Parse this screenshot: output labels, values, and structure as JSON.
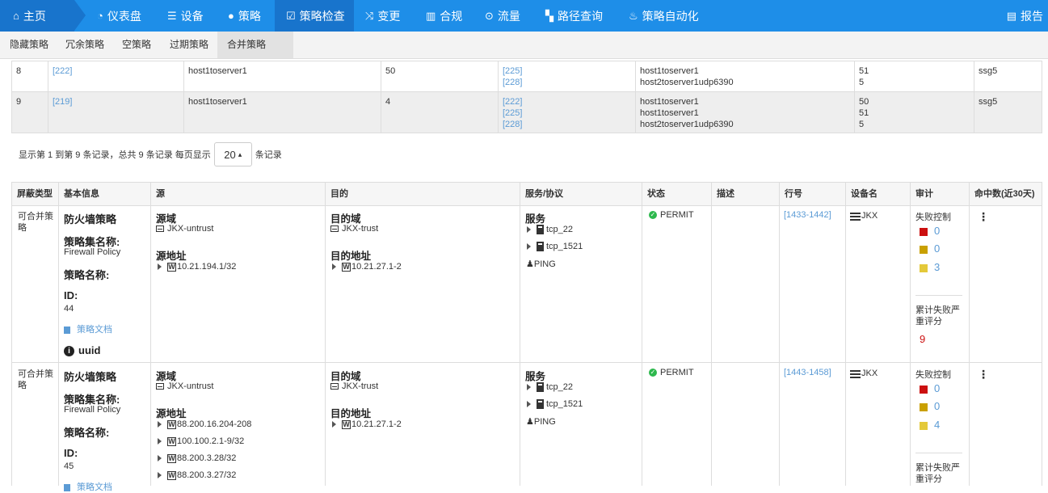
{
  "nav": {
    "home": "主页",
    "items": [
      "仪表盘",
      "设备",
      "策略",
      "策略检查",
      "变更",
      "合规",
      "流量",
      "路径查询",
      "策略自动化"
    ],
    "report": "报告"
  },
  "subnav": [
    "隐藏策略",
    "冗余策略",
    "空策略",
    "过期策略",
    "合并策略"
  ],
  "upper_rows": [
    {
      "no": "8",
      "id": "[222]",
      "name": "host1toserver1",
      "count": "50",
      "merge_ids": [
        "[225]",
        "[228]"
      ],
      "merge_names": [
        "host1toserver1",
        "host2toserver1udp6390"
      ],
      "merge_counts": [
        "51",
        "5"
      ],
      "device": "ssg5"
    },
    {
      "no": "9",
      "id": "[219]",
      "name": "host1toserver1",
      "count": "4",
      "merge_ids": [
        "[222]",
        "[225]",
        "[228]"
      ],
      "merge_names": [
        "host1toserver1",
        "host1toserver1",
        "host2toserver1udp6390"
      ],
      "merge_counts": [
        "50",
        "51",
        "5"
      ],
      "device": "ssg5"
    }
  ],
  "pager": {
    "text_before": "显示第 1 到第 9 条记录，总共 9 条记录 每页显示",
    "page_size": "20",
    "caret": "▴",
    "text_after": "条记录"
  },
  "headers": [
    "屏蔽类型",
    "基本信息",
    "源",
    "目的",
    "服务/协议",
    "状态",
    "描述",
    "行号",
    "设备名",
    "审计",
    "命中数(近30天)"
  ],
  "labels": {
    "policy_type": "防火墙策略",
    "set_label": "策略集名称:",
    "name_label": "策略名称:",
    "id_label": "ID:",
    "doc": "策略文档",
    "uuid": "uuid",
    "src_zone": "源域",
    "src_addr": "源地址",
    "dst_zone": "目的域",
    "dst_addr": "目的地址",
    "service": "服务",
    "fail_ctrl": "失败控制",
    "cum_score": "累计失败严重评分"
  },
  "rows": [
    {
      "type": "可合并策略",
      "set_name": "Firewall Policy",
      "id": "44",
      "src_zone": "JKX-untrust",
      "src_addrs": [
        "10.21.194.1/32"
      ],
      "dst_zone": "JKX-trust",
      "dst_addrs": [
        "10.21.27.1-2"
      ],
      "services": [
        "tcp_22",
        "tcp_1521"
      ],
      "ping": "PING",
      "status": "PERMIT",
      "line": "[1433-1442]",
      "device": "JKX",
      "audit": [
        "0",
        "0",
        "3"
      ],
      "score": "9"
    },
    {
      "type": "可合并策略",
      "set_name": "Firewall Policy",
      "id": "45",
      "src_zone": "JKX-untrust",
      "src_addrs": [
        "88.200.16.204-208",
        "100.100.2.1-9/32",
        "88.200.3.28/32",
        "88.200.3.27/32"
      ],
      "dst_zone": "JKX-trust",
      "dst_addrs": [
        "10.21.27.1-2"
      ],
      "services": [
        "tcp_22",
        "tcp_1521"
      ],
      "ping": "PING",
      "status": "PERMIT",
      "line": "[1443-1458]",
      "device": "JKX",
      "audit": [
        "0",
        "0",
        "4"
      ],
      "score": ""
    }
  ],
  "colors": {
    "nav": "#1e8ee8",
    "nav_active": "#1874cc",
    "link": "#5b9bd5",
    "red": "#cc1010",
    "olive": "#c9a000",
    "yellow": "#e4c93a",
    "green": "#2db84d"
  }
}
